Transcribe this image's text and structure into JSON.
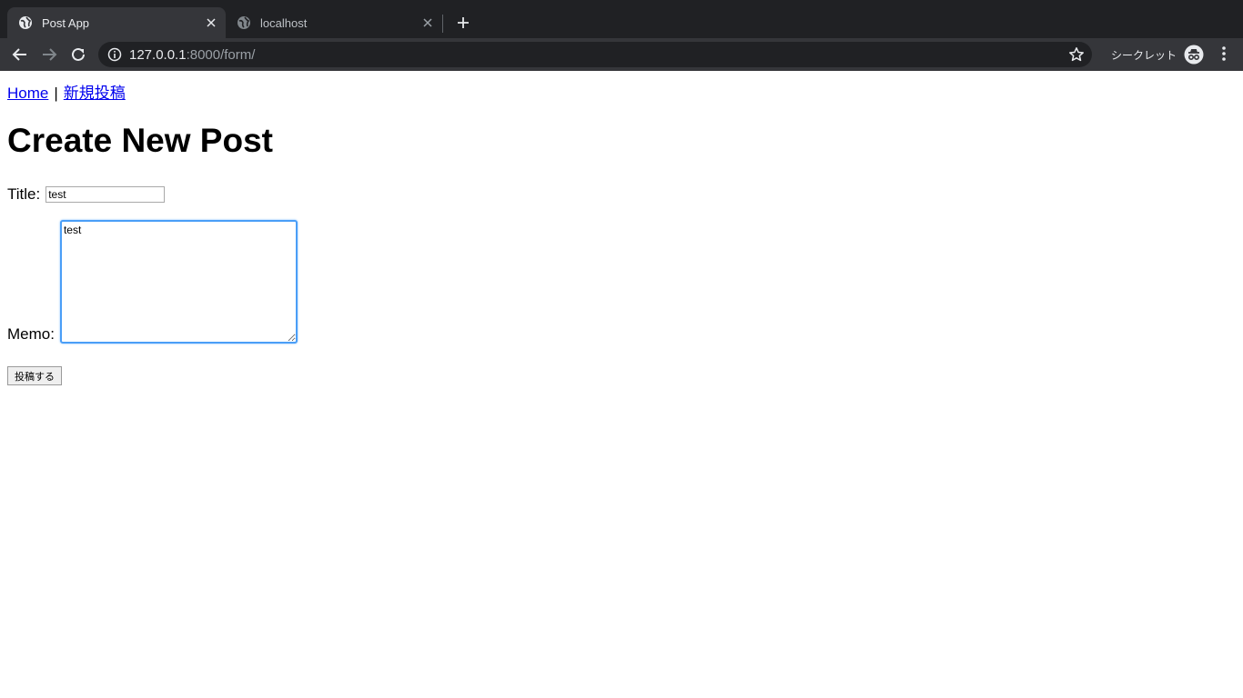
{
  "browser": {
    "tabs": [
      {
        "title": "Post App",
        "active": true
      },
      {
        "title": "localhost",
        "active": false
      }
    ],
    "url_host": "127.0.0.1",
    "url_rest": ":8000/form/",
    "incognito_label": "シークレット",
    "colors": {
      "chrome_dark": "#202124",
      "chrome_toolbar": "#35363a",
      "chrome_text": "#e8eaed"
    }
  },
  "nav": {
    "home": "Home",
    "separator": "|",
    "new_post": "新規投稿"
  },
  "page": {
    "title": "Create New Post"
  },
  "form": {
    "title_label": "Title:",
    "title_value": "test",
    "memo_label": "Memo:",
    "memo_value": "test",
    "submit_label": "投稿する"
  },
  "colors": {
    "link": "#0000ee",
    "focus_ring": "#4a9ef7"
  }
}
